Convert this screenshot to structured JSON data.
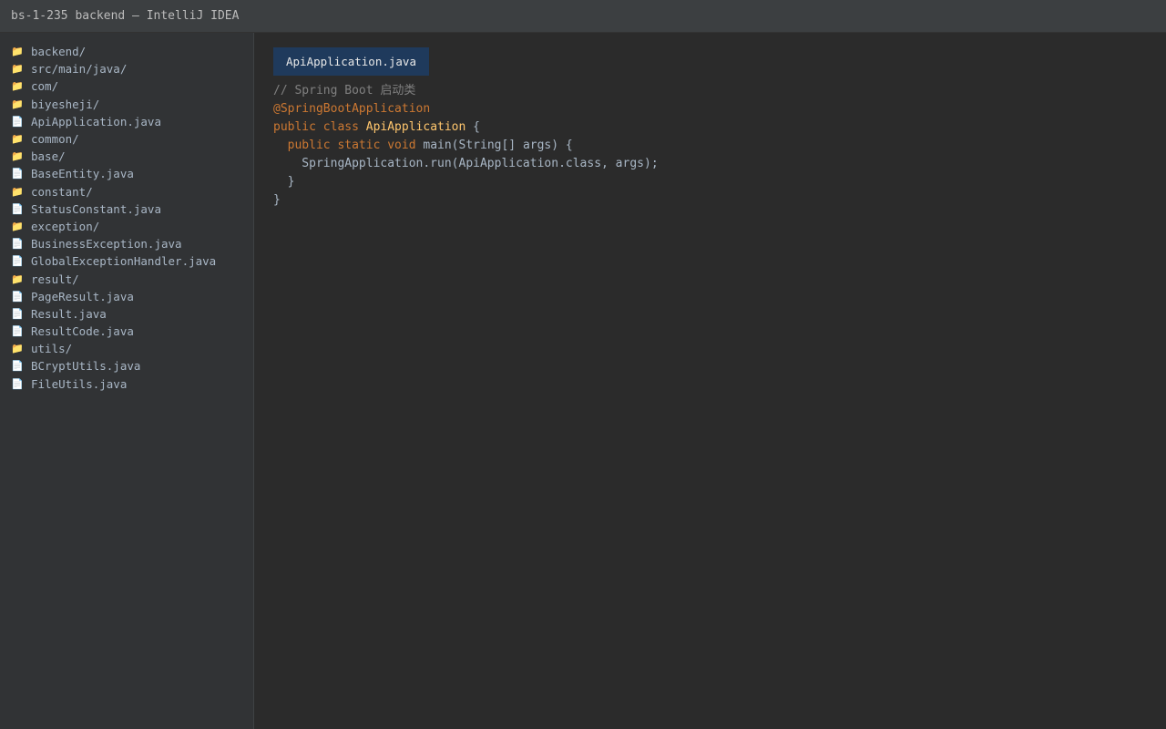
{
  "window": {
    "title": "bs-1-235 backend — IntelliJ IDEA"
  },
  "sidebar": {
    "items": [
      {
        "type": "folder",
        "label": "backend/"
      },
      {
        "type": "folder",
        "label": "src/main/java/"
      },
      {
        "type": "folder",
        "label": "com/"
      },
      {
        "type": "folder",
        "label": "biyesheji/"
      },
      {
        "type": "file",
        "label": "ApiApplication.java"
      },
      {
        "type": "folder",
        "label": "common/"
      },
      {
        "type": "folder",
        "label": "base/"
      },
      {
        "type": "file",
        "label": "BaseEntity.java"
      },
      {
        "type": "folder",
        "label": "constant/"
      },
      {
        "type": "file",
        "label": "StatusConstant.java"
      },
      {
        "type": "folder",
        "label": "exception/"
      },
      {
        "type": "file",
        "label": "BusinessException.java"
      },
      {
        "type": "file",
        "label": "GlobalExceptionHandler.java"
      },
      {
        "type": "folder",
        "label": "result/"
      },
      {
        "type": "file",
        "label": "PageResult.java"
      },
      {
        "type": "file",
        "label": "Result.java"
      },
      {
        "type": "file",
        "label": "ResultCode.java"
      },
      {
        "type": "folder",
        "label": "utils/"
      },
      {
        "type": "file",
        "label": "BCryptUtils.java"
      },
      {
        "type": "file",
        "label": "FileUtils.java"
      }
    ],
    "icons": {
      "folder": "folder-icon",
      "file": "file-icon"
    }
  },
  "editor": {
    "active_tab": "ApiApplication.java",
    "lines": [
      [
        {
          "k": "comment",
          "t": "// Spring Boot 启动类"
        }
      ],
      [
        {
          "k": "annotation",
          "t": "@SpringBootApplication"
        }
      ],
      [
        {
          "k": "keyword",
          "t": "public class "
        },
        {
          "k": "classname",
          "t": "ApiApplication"
        },
        {
          "k": "plain",
          "t": " {"
        }
      ],
      [
        {
          "k": "plain",
          "t": "  "
        },
        {
          "k": "keyword",
          "t": "public static void "
        },
        {
          "k": "plain",
          "t": "main(String[] args) {"
        }
      ],
      [
        {
          "k": "plain",
          "t": "    SpringApplication.run(ApiApplication.class, args);"
        }
      ],
      [
        {
          "k": "plain",
          "t": "  }"
        }
      ],
      [
        {
          "k": "plain",
          "t": "}"
        }
      ]
    ]
  },
  "colors": {
    "titlebar_bg": "#3c3f41",
    "sidebar_bg": "#313335",
    "editor_bg": "#2b2b2b",
    "tab_active_bg": "#1f3a5c",
    "keyword": "#cc7832",
    "classname": "#ffc66d",
    "comment": "#808080",
    "text": "#a9b7c6"
  }
}
